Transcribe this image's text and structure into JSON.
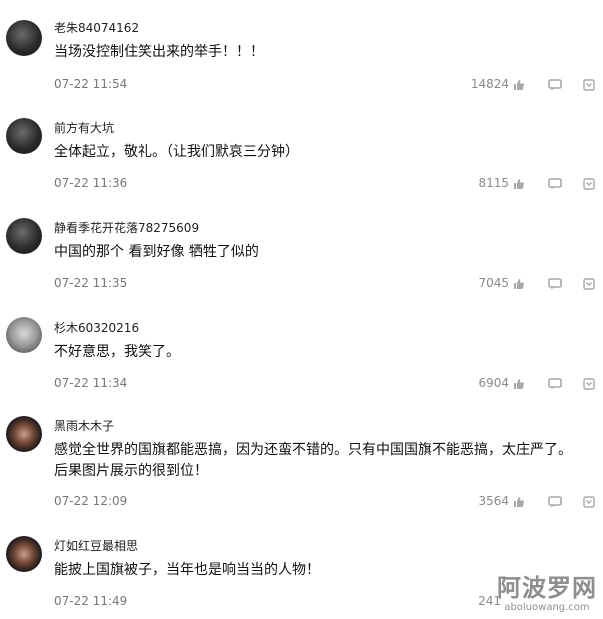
{
  "comments": [
    {
      "username": "老朱84074162",
      "text": "当场没控制住笑出来的举手！！！",
      "time": "07-22 11:54",
      "likes": "14824"
    },
    {
      "username": "前方有大坑",
      "text": "全体起立，敬礼。（让我们默哀三分钟）",
      "time": "07-22 11:36",
      "likes": "8115"
    },
    {
      "username": "静看季花开花落78275609",
      "text": "中国的那个 看到好像 牺牲了似的",
      "time": "07-22 11:35",
      "likes": "7045"
    },
    {
      "username": "杉木60320216",
      "text": "不好意思，我笑了。",
      "time": "07-22 11:34",
      "likes": "6904"
    },
    {
      "username": "黑雨木木子",
      "text": "感觉全世界的国旗都能恶搞，因为还蛮不错的。只有中国国旗不能恶搞，太庄严了。",
      "text2": "后果图片展示的很到位！",
      "time": "07-22 12:09",
      "likes": "3564"
    },
    {
      "username": "灯如红豆最相思",
      "text": "能披上国旗被子，当年也是响当当的人物！",
      "time": "07-22 11:49",
      "likes": "241"
    }
  ],
  "icons": {
    "like": "thumbs-up-icon",
    "reply": "reply-bubble-icon",
    "more": "more-chevron-icon"
  },
  "watermark": {
    "cn": "阿波罗网",
    "url": "aboluowang.com"
  },
  "colors": {
    "text": "#111111",
    "meta": "#777777",
    "icon": "#9a9a9a"
  }
}
